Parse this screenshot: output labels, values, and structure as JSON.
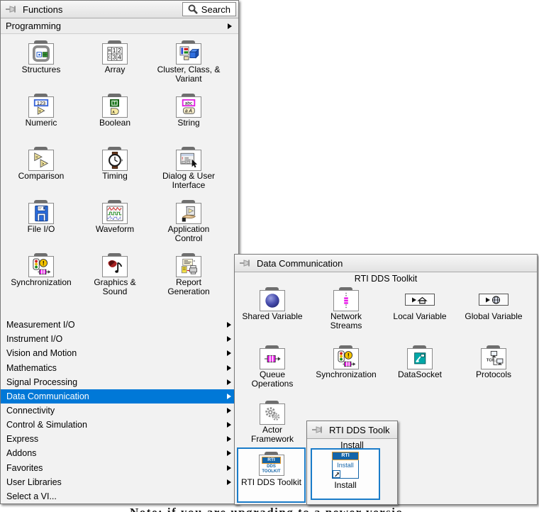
{
  "background_text": "Note: if you are upgrading to a newer versio",
  "colors": {
    "selection_blue": "#0078d7",
    "box_blue": "#1a7cc9",
    "rti_blue": "#1565a8",
    "rti_orange": "#e89b2d"
  },
  "functions_palette": {
    "title": "Functions",
    "search_label": "Search",
    "programming_label": "Programming",
    "grid_items": [
      {
        "label": "Structures",
        "icon": "structures-icon"
      },
      {
        "label": "Array",
        "icon": "array-icon"
      },
      {
        "label": "Cluster, Class, &\nVariant",
        "icon": "cluster-class-variant-icon"
      },
      {
        "label": "Numeric",
        "icon": "numeric-icon"
      },
      {
        "label": "Boolean",
        "icon": "boolean-icon"
      },
      {
        "label": "String",
        "icon": "string-icon"
      },
      {
        "label": "Comparison",
        "icon": "comparison-icon"
      },
      {
        "label": "Timing",
        "icon": "timing-icon"
      },
      {
        "label": "Dialog & User\nInterface",
        "icon": "dialog-user-interface-icon"
      },
      {
        "label": "File I/O",
        "icon": "file-io-icon"
      },
      {
        "label": "Waveform",
        "icon": "waveform-icon"
      },
      {
        "label": "Application\nControl",
        "icon": "application-control-icon"
      },
      {
        "label": "Synchronization",
        "icon": "synchronization-icon"
      },
      {
        "label": "Graphics &\nSound",
        "icon": "graphics-sound-icon"
      },
      {
        "label": "Report\nGeneration",
        "icon": "report-generation-icon"
      }
    ],
    "categories": [
      {
        "label": "Measurement I/O",
        "arrow": true
      },
      {
        "label": "Instrument I/O",
        "arrow": true
      },
      {
        "label": "Vision and Motion",
        "arrow": true
      },
      {
        "label": "Mathematics",
        "arrow": true
      },
      {
        "label": "Signal Processing",
        "arrow": true
      },
      {
        "label": "Data Communication",
        "arrow": true,
        "selected": true
      },
      {
        "label": "Connectivity",
        "arrow": true
      },
      {
        "label": "Control & Simulation",
        "arrow": true
      },
      {
        "label": "Express",
        "arrow": true
      },
      {
        "label": "Addons",
        "arrow": true
      },
      {
        "label": "Favorites",
        "arrow": true
      },
      {
        "label": "User Libraries",
        "arrow": true
      },
      {
        "label": "Select a VI...",
        "arrow": false
      }
    ]
  },
  "dc_palette": {
    "title": "Data Communication",
    "section_label": "RTI DDS Toolkit",
    "grid_items": [
      {
        "label": "Shared Variable",
        "icon": "shared-variable-icon"
      },
      {
        "label": "Network\nStreams",
        "icon": "network-streams-icon"
      },
      {
        "label": "Local Variable",
        "icon": "local-variable-icon"
      },
      {
        "label": "Global Variable",
        "icon": "global-variable-icon"
      },
      {
        "label": "Queue\nOperations",
        "icon": "queue-operations-icon"
      },
      {
        "label": "Synchronization",
        "icon": "synchronization-icon"
      },
      {
        "label": "DataSocket",
        "icon": "datasocket-icon"
      },
      {
        "label": "Protocols",
        "icon": "protocols-icon"
      },
      {
        "label": "Actor\nFramework",
        "icon": "actor-framework-icon"
      }
    ],
    "toolkit_item": {
      "label": "RTI DDS Toolkit",
      "icon_band": "RTI",
      "icon_body": "DDS\nTOOLKIT"
    }
  },
  "rti_palette": {
    "title": "RTI DDS Toolk",
    "section_label": "Install",
    "install_item": {
      "label": "Install",
      "icon_band": "RTI",
      "icon_body": "Install"
    }
  }
}
